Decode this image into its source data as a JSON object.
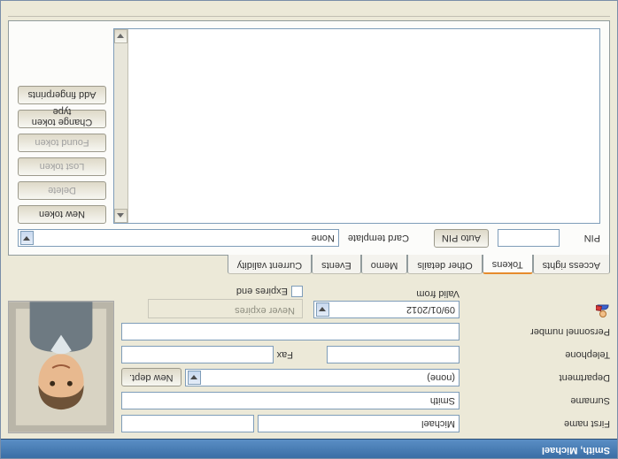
{
  "title": "Smith, Michael",
  "labels": {
    "first_name": "First name",
    "surname": "Surname",
    "department": "Department",
    "telephone": "Telephone",
    "fax": "Fax",
    "personnel_number": "Personnel number",
    "valid_from": "Valid from",
    "expires_end": "Expires end",
    "never_expires": "Never expires",
    "pin": "PIN",
    "card_template": "Card template"
  },
  "values": {
    "first_name": "Michael",
    "surname": "Smith",
    "department": "(none)",
    "telephone": "",
    "fax": "",
    "personnel_number": "",
    "valid_from": "09/01/2012",
    "pin": "",
    "card_template": "None"
  },
  "buttons": {
    "new_dept": "New dept.",
    "auto_pin": "Auto PIN",
    "new_token": "New token",
    "delete": "Delete",
    "lost_token": "Lost token",
    "found_token": "Found token",
    "change_token_type": "Change token type",
    "add_fingerprints": "Add fingerprints"
  },
  "tabs": {
    "access_rights": "Access rights",
    "tokens": "Tokens",
    "other_details": "Other details",
    "memo": "Memo",
    "events": "Events",
    "current_validity": "Current validity"
  }
}
